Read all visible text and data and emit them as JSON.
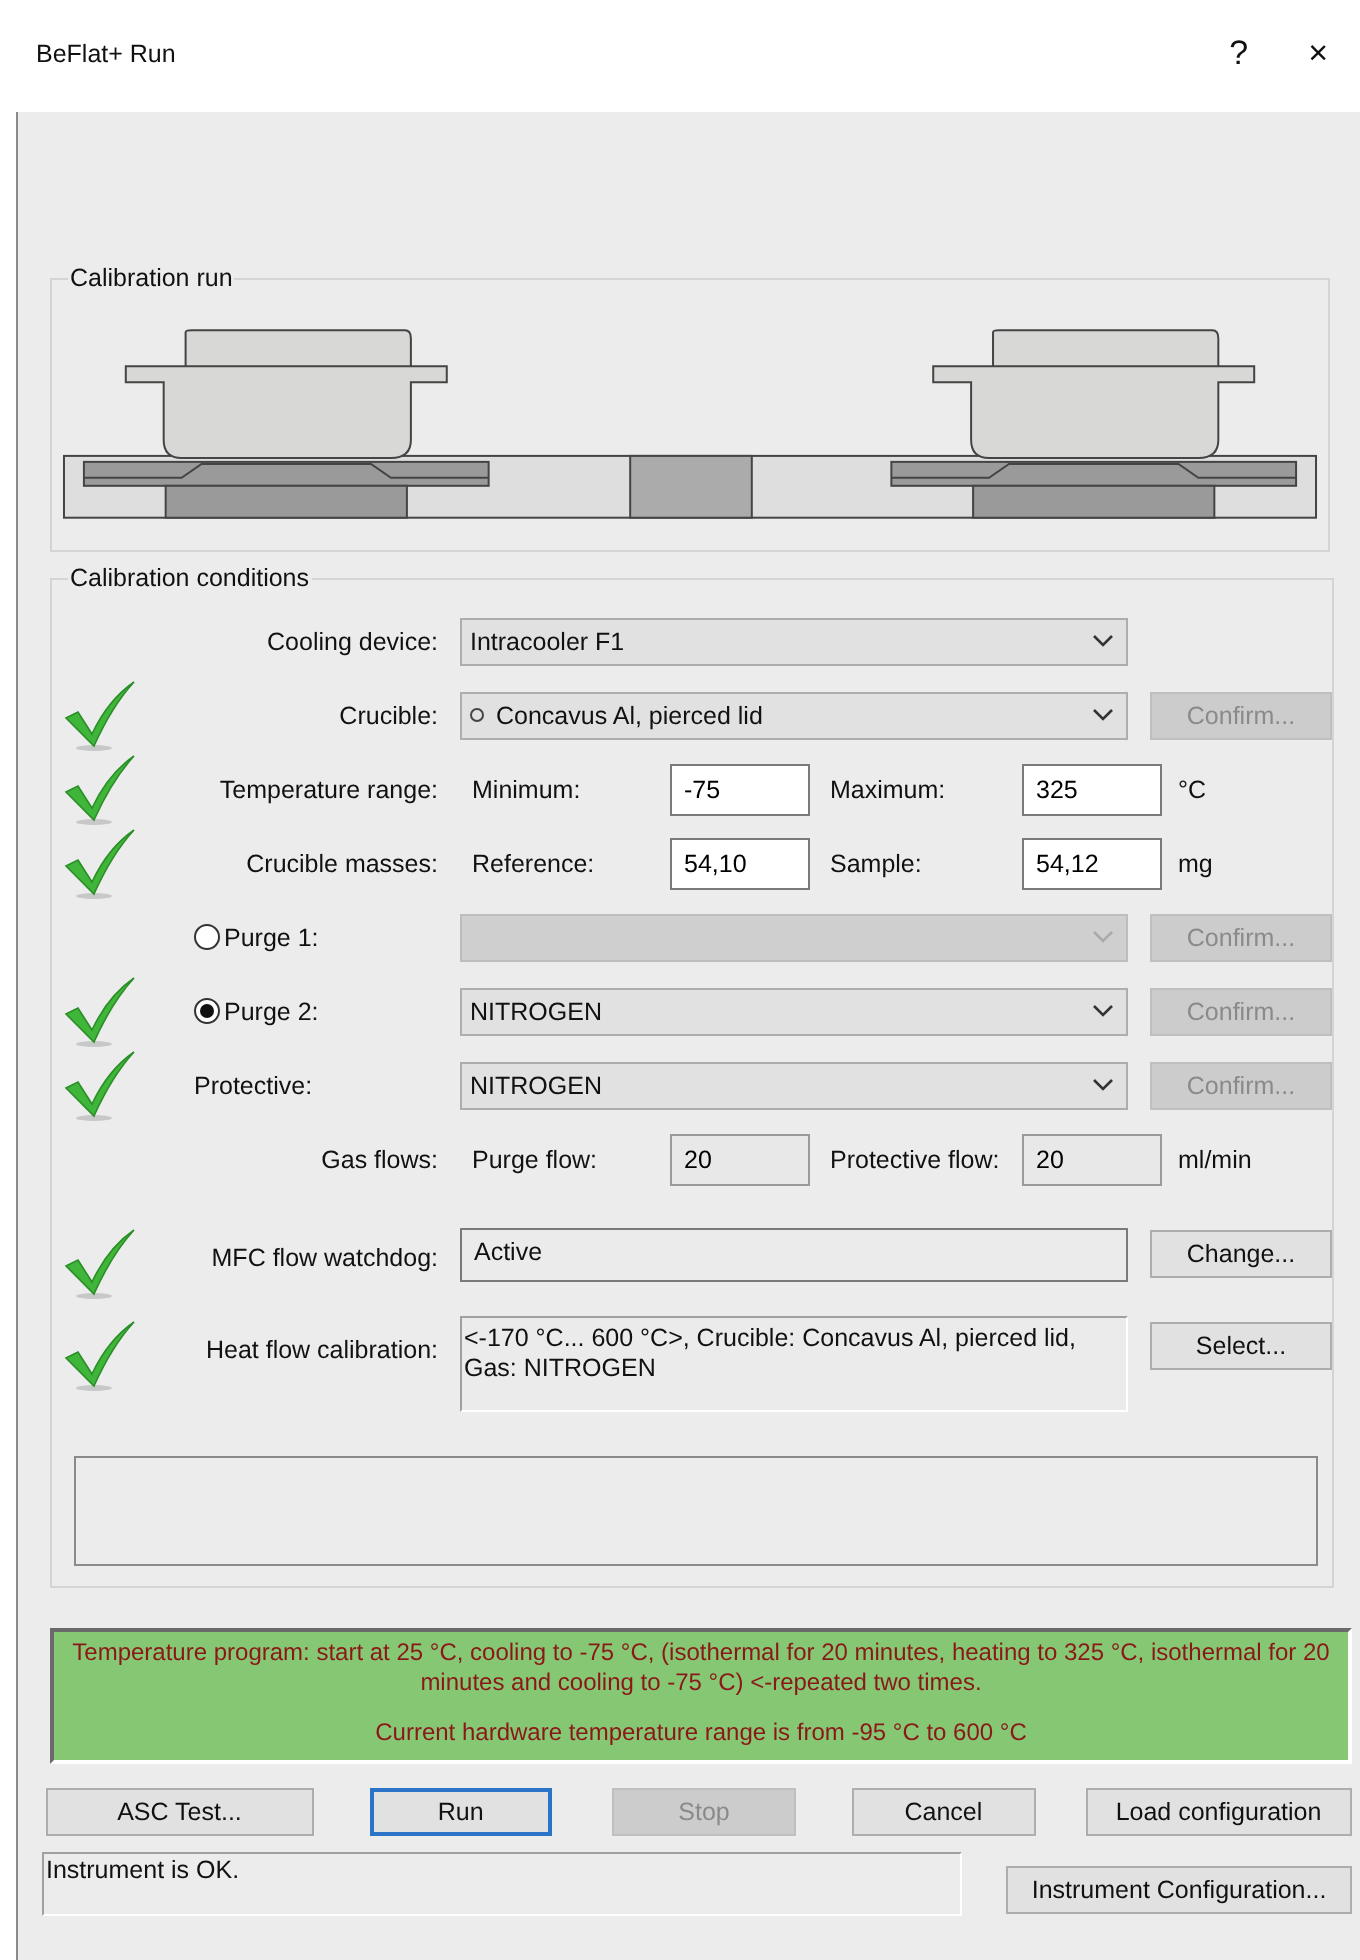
{
  "window": {
    "title": "BeFlat+ Run",
    "help": "?",
    "close": "×"
  },
  "calibration_run": {
    "title": "Calibration run"
  },
  "calibration_conditions": {
    "title": "Calibration conditions",
    "rows": [
      {
        "kind": "select",
        "label": "Cooling device:",
        "value": "Intracooler F1",
        "verified": false
      },
      {
        "kind": "select",
        "label": "Crucible:",
        "value": "Concavus Al, pierced lid",
        "verified": true,
        "button": {
          "label": "Confirm...",
          "disabled": true
        }
      },
      {
        "kind": "pair",
        "label": "Temperature range:",
        "verified": true,
        "fields": [
          {
            "label": "Minimum:",
            "value": "-75",
            "readonly": false
          },
          {
            "label": "Maximum:",
            "value": "325",
            "readonly": false
          }
        ],
        "unit": "°C"
      },
      {
        "kind": "pair",
        "label": "Crucible masses:",
        "verified": true,
        "fields": [
          {
            "label": "Reference:",
            "value": "54,10",
            "readonly": false
          },
          {
            "label": "Sample:",
            "value": "54,12",
            "readonly": false
          }
        ],
        "unit": "mg"
      },
      {
        "kind": "radio",
        "label": "Purge 1:",
        "selected": false,
        "disabled": true,
        "verified": false,
        "button": {
          "label": "Confirm...",
          "disabled": true
        }
      },
      {
        "kind": "radio",
        "label": "Purge 2:",
        "selected": true,
        "disabled": false,
        "value": "NITROGEN",
        "verified": true,
        "button": {
          "label": "Confirm...",
          "disabled": true
        }
      },
      {
        "kind": "gas",
        "label": "Protective:",
        "value": "NITROGEN",
        "verified": true,
        "button": {
          "label": "Confirm...",
          "disabled": true
        }
      },
      {
        "kind": "pair",
        "label": "Gas flows:",
        "verified": false,
        "fields": [
          {
            "label": "Purge flow:",
            "value": "20",
            "readonly": true
          },
          {
            "label": "Protective flow:",
            "value": "20",
            "readonly": true
          }
        ],
        "unit": "ml/min"
      },
      {
        "kind": "text",
        "label": "MFC flow watchdog:",
        "value": "Active",
        "verified": true,
        "button": {
          "label": "Change...",
          "disabled": false
        }
      },
      {
        "kind": "textarea",
        "label": "Heat flow calibration:",
        "value": "<-170 °C... 600 °C>, Crucible: Concavus Al, pierced lid, Gas: NITROGEN",
        "verified": true,
        "button": {
          "label": "Select...",
          "disabled": false
        }
      }
    ]
  },
  "program_message": [
    "Temperature program: start at 25 °C, cooling to -75 °C, (isothermal for 20 minutes, heating to 325 °C, isothermal for 20 minutes and cooling to -75 °C) <-repeated two times.",
    "Current hardware temperature range is from -95 °C to 600 °C"
  ],
  "buttons": [
    {
      "label": "ASC Test...",
      "disabled": false,
      "default": false
    },
    {
      "label": "Run",
      "disabled": false,
      "default": true
    },
    {
      "label": "Stop",
      "disabled": true,
      "default": false
    },
    {
      "label": "Cancel",
      "disabled": false,
      "default": false
    },
    {
      "label": "Load configuration",
      "disabled": false,
      "default": false
    }
  ],
  "status": "Instrument is OK.",
  "instrument_button": "Instrument Configuration..."
}
